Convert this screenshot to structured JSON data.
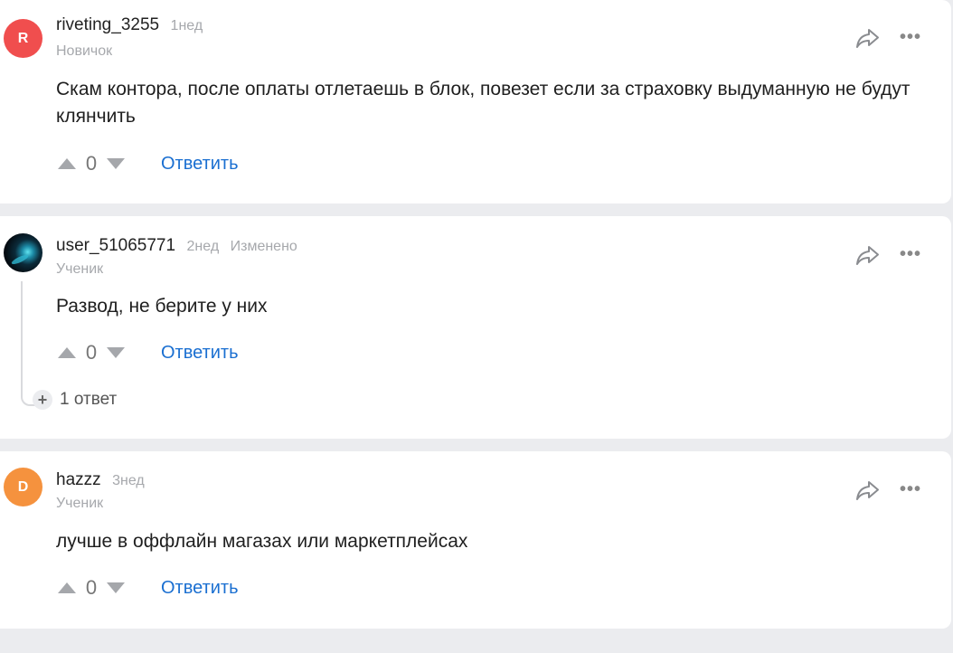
{
  "comments": [
    {
      "avatar_letter": "R",
      "avatar_color": "#f04e4e",
      "author": "riveting_3255",
      "time": "1нед",
      "edited": "",
      "rank": "Новичок",
      "text": "Скам контора, после оплаты отлетаешь в блок, повезет если за страховку выдуманную не будут клянчить",
      "score": "0",
      "reply_label": "Ответить"
    },
    {
      "avatar_letter": "",
      "avatar_color": "#0b2b3a",
      "author": "user_51065771",
      "time": "2нед",
      "edited": "Изменено",
      "rank": "Ученик",
      "text": "Развод, не берите у них",
      "score": "0",
      "reply_label": "Ответить",
      "replies_label": "1 ответ"
    },
    {
      "avatar_letter": "D",
      "avatar_color": "#f5923e",
      "author": "hazzz",
      "time": "3нед",
      "edited": "",
      "rank": "Ученик",
      "text": "лучше в оффлайн магазах или маркетплейсах",
      "score": "0",
      "reply_label": "Ответить"
    }
  ],
  "icons": {
    "share": "share-icon",
    "more": "more-icon",
    "upvote": "arrow-up-icon",
    "downvote": "arrow-down-icon",
    "expand": "plus-icon"
  },
  "more_glyph": "•••",
  "plus_glyph": "+"
}
